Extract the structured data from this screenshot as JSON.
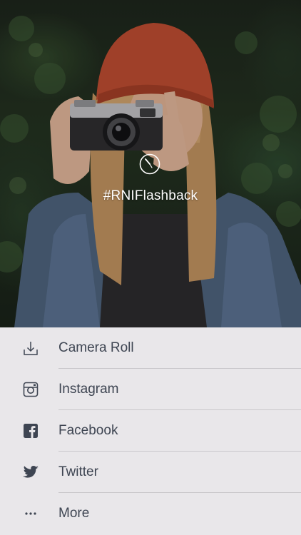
{
  "photo": {
    "hashtag": "#RNIFlashback"
  },
  "share_menu": {
    "items": [
      {
        "label": "Camera Roll",
        "icon": "download-icon"
      },
      {
        "label": "Instagram",
        "icon": "instagram-icon"
      },
      {
        "label": "Facebook",
        "icon": "facebook-icon"
      },
      {
        "label": "Twitter",
        "icon": "twitter-icon"
      },
      {
        "label": "More",
        "icon": "more-icon"
      }
    ]
  },
  "colors": {
    "sheet_background": "#e9e7ea",
    "label_text": "#3e4552",
    "icon": "#3e4552",
    "divider": "#c9c7cb",
    "hashtag_text": "#ffffff"
  }
}
